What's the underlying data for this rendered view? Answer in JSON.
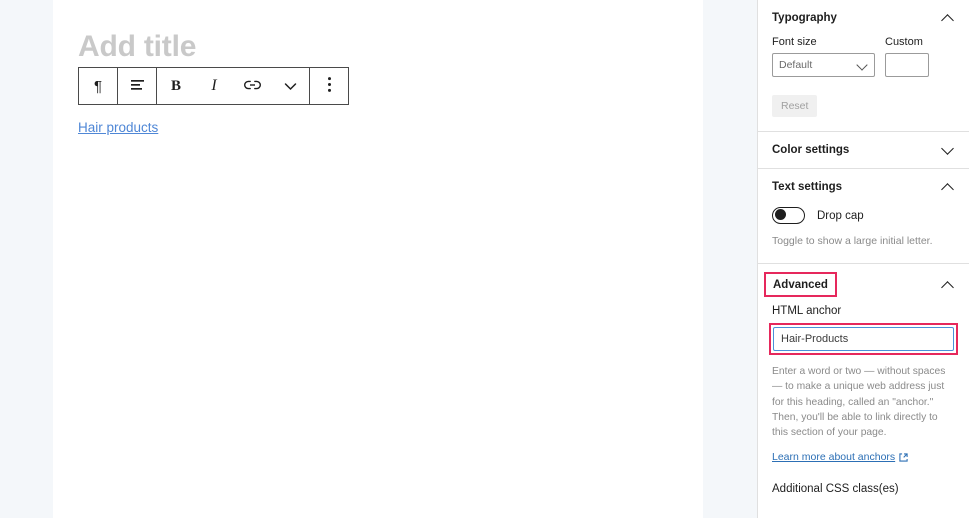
{
  "editor": {
    "title_placeholder": "Add title",
    "toolbar": {
      "paragraph_label": "¶",
      "align_label": "align-text",
      "bold_label": "B",
      "italic_label": "I",
      "link_label": "link",
      "more_formatting_label": "chevron-down",
      "options_label": "kebab-menu"
    },
    "content": {
      "link_text": "Hair products"
    }
  },
  "sidebar": {
    "typography": {
      "title": "Typography",
      "chevron": "up",
      "font_size_label": "Font size",
      "font_size_value": "Default",
      "font_size_options": [
        "Default"
      ],
      "custom_label": "Custom",
      "custom_value": "",
      "reset_label": "Reset"
    },
    "color_settings": {
      "title": "Color settings",
      "chevron": "down"
    },
    "text_settings": {
      "title": "Text settings",
      "chevron": "up",
      "drop_cap_label": "Drop cap",
      "drop_cap_state": "off",
      "drop_cap_help": "Toggle to show a large initial letter."
    },
    "advanced": {
      "title": "Advanced",
      "chevron": "up",
      "html_anchor_label": "HTML anchor",
      "html_anchor_value": "Hair-Products",
      "anchor_help": "Enter a word or two — without spaces — to make a unique web address just for this heading, called an \"anchor.\" Then, you'll be able to link directly to this section of your page.",
      "learn_more_label": "Learn more about anchors",
      "css_classes_label": "Additional CSS class(es)"
    }
  },
  "colors": {
    "highlight": "#e6285c",
    "focus_border": "#4a90d9",
    "link": "#2c6fb5",
    "content_link": "#4f87d6",
    "rail_bg": "#f4f7fa"
  }
}
